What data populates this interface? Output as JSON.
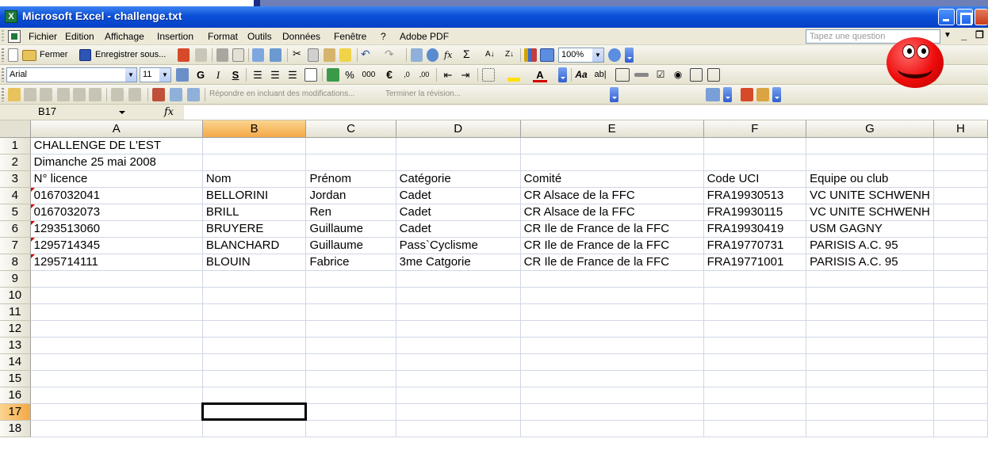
{
  "window": {
    "title": "Microsoft Excel - challenge.txt"
  },
  "menu": {
    "items": [
      "Fichier",
      "Edition",
      "Affichage",
      "Insertion",
      "Format",
      "Outils",
      "Données",
      "Fenêtre",
      "?",
      "Adobe PDF"
    ],
    "help_placeholder": "Tapez une question"
  },
  "toolbar_standard": {
    "close_label": "Fermer",
    "save_as_label": "Enregistrer sous...",
    "zoom": "100%"
  },
  "toolbar_format": {
    "font": "Arial",
    "size": "11",
    "bold": "G",
    "italic": "I",
    "underline": "S",
    "percent": "%",
    "thousands": "000",
    "euro": "€"
  },
  "toolbar_review": {
    "reply_label": "Répondre en incluant des modifications...",
    "end_review_label": "Terminer la révision..."
  },
  "formula_bar": {
    "name_box": "B17",
    "fx": "fx",
    "formula": ""
  },
  "sheet": {
    "columns": [
      "A",
      "B",
      "C",
      "D",
      "E",
      "F",
      "G",
      "H"
    ],
    "active_column": "B",
    "active_row": 17,
    "selected_cell": "B17",
    "rows": [
      {
        "n": "1",
        "cells": [
          "CHALLENGE DE L'EST",
          "",
          "",
          "",
          "",
          "",
          "",
          ""
        ]
      },
      {
        "n": "2",
        "cells": [
          "Dimanche 25 mai 2008",
          "",
          "",
          "",
          "",
          "",
          "",
          ""
        ]
      },
      {
        "n": "3",
        "cells": [
          "N° licence",
          "Nom",
          "Prénom",
          "Catégorie",
          "Comité",
          "Code UCI",
          "Equipe ou club",
          ""
        ]
      },
      {
        "n": "4",
        "cells": [
          "0167032041",
          "BELLORINI",
          "Jordan",
          "Cadet",
          "CR Alsace de la FFC",
          "FRA19930513",
          "VC UNITE SCHWENH",
          ""
        ]
      },
      {
        "n": "5",
        "cells": [
          "0167032073",
          "BRILL",
          "Ren",
          "Cadet",
          "CR Alsace de la FFC",
          "FRA19930115",
          "VC UNITE SCHWENH",
          ""
        ]
      },
      {
        "n": "6",
        "cells": [
          "1293513060",
          "BRUYERE",
          "Guillaume",
          "Cadet",
          "CR Ile de France de la FFC",
          "FRA19930419",
          "USM GAGNY",
          ""
        ]
      },
      {
        "n": "7",
        "cells": [
          "1295714345",
          "BLANCHARD",
          "Guillaume",
          "Pass`Cyclisme",
          "CR Ile de France de la FFC",
          "FRA19770731",
          "PARISIS A.C. 95",
          ""
        ]
      },
      {
        "n": "8",
        "cells": [
          "1295714111",
          "BLOUIN",
          "Fabrice",
          "3me Catgorie",
          "CR Ile de France de la FFC",
          "FRA19771001",
          "PARISIS A.C. 95",
          ""
        ]
      },
      {
        "n": "9",
        "cells": [
          "",
          "",
          "",
          "",
          "",
          "",
          "",
          ""
        ]
      },
      {
        "n": "10",
        "cells": [
          "",
          "",
          "",
          "",
          "",
          "",
          "",
          ""
        ]
      },
      {
        "n": "11",
        "cells": [
          "",
          "",
          "",
          "",
          "",
          "",
          "",
          ""
        ]
      },
      {
        "n": "12",
        "cells": [
          "",
          "",
          "",
          "",
          "",
          "",
          "",
          ""
        ]
      },
      {
        "n": "13",
        "cells": [
          "",
          "",
          "",
          "",
          "",
          "",
          "",
          ""
        ]
      },
      {
        "n": "14",
        "cells": [
          "",
          "",
          "",
          "",
          "",
          "",
          "",
          ""
        ]
      },
      {
        "n": "15",
        "cells": [
          "",
          "",
          "",
          "",
          "",
          "",
          "",
          ""
        ]
      },
      {
        "n": "16",
        "cells": [
          "",
          "",
          "",
          "",
          "",
          "",
          "",
          ""
        ]
      },
      {
        "n": "17",
        "cells": [
          "",
          "",
          "",
          "",
          "",
          "",
          "",
          ""
        ]
      },
      {
        "n": "18",
        "cells": [
          "",
          "",
          "",
          "",
          "",
          "",
          "",
          ""
        ]
      }
    ],
    "comment_rows": [
      "4",
      "5",
      "6",
      "7",
      "8"
    ]
  },
  "colors": {
    "title_bar": "#0a4fd8",
    "header_active": "#f4a846",
    "comment_marker": "#d40000",
    "gridline": "#d0d7e5"
  },
  "icons": [
    "excel-app-icon",
    "minimize-icon",
    "maximize-icon",
    "close-icon",
    "smiley-icon",
    "fx-icon"
  ]
}
